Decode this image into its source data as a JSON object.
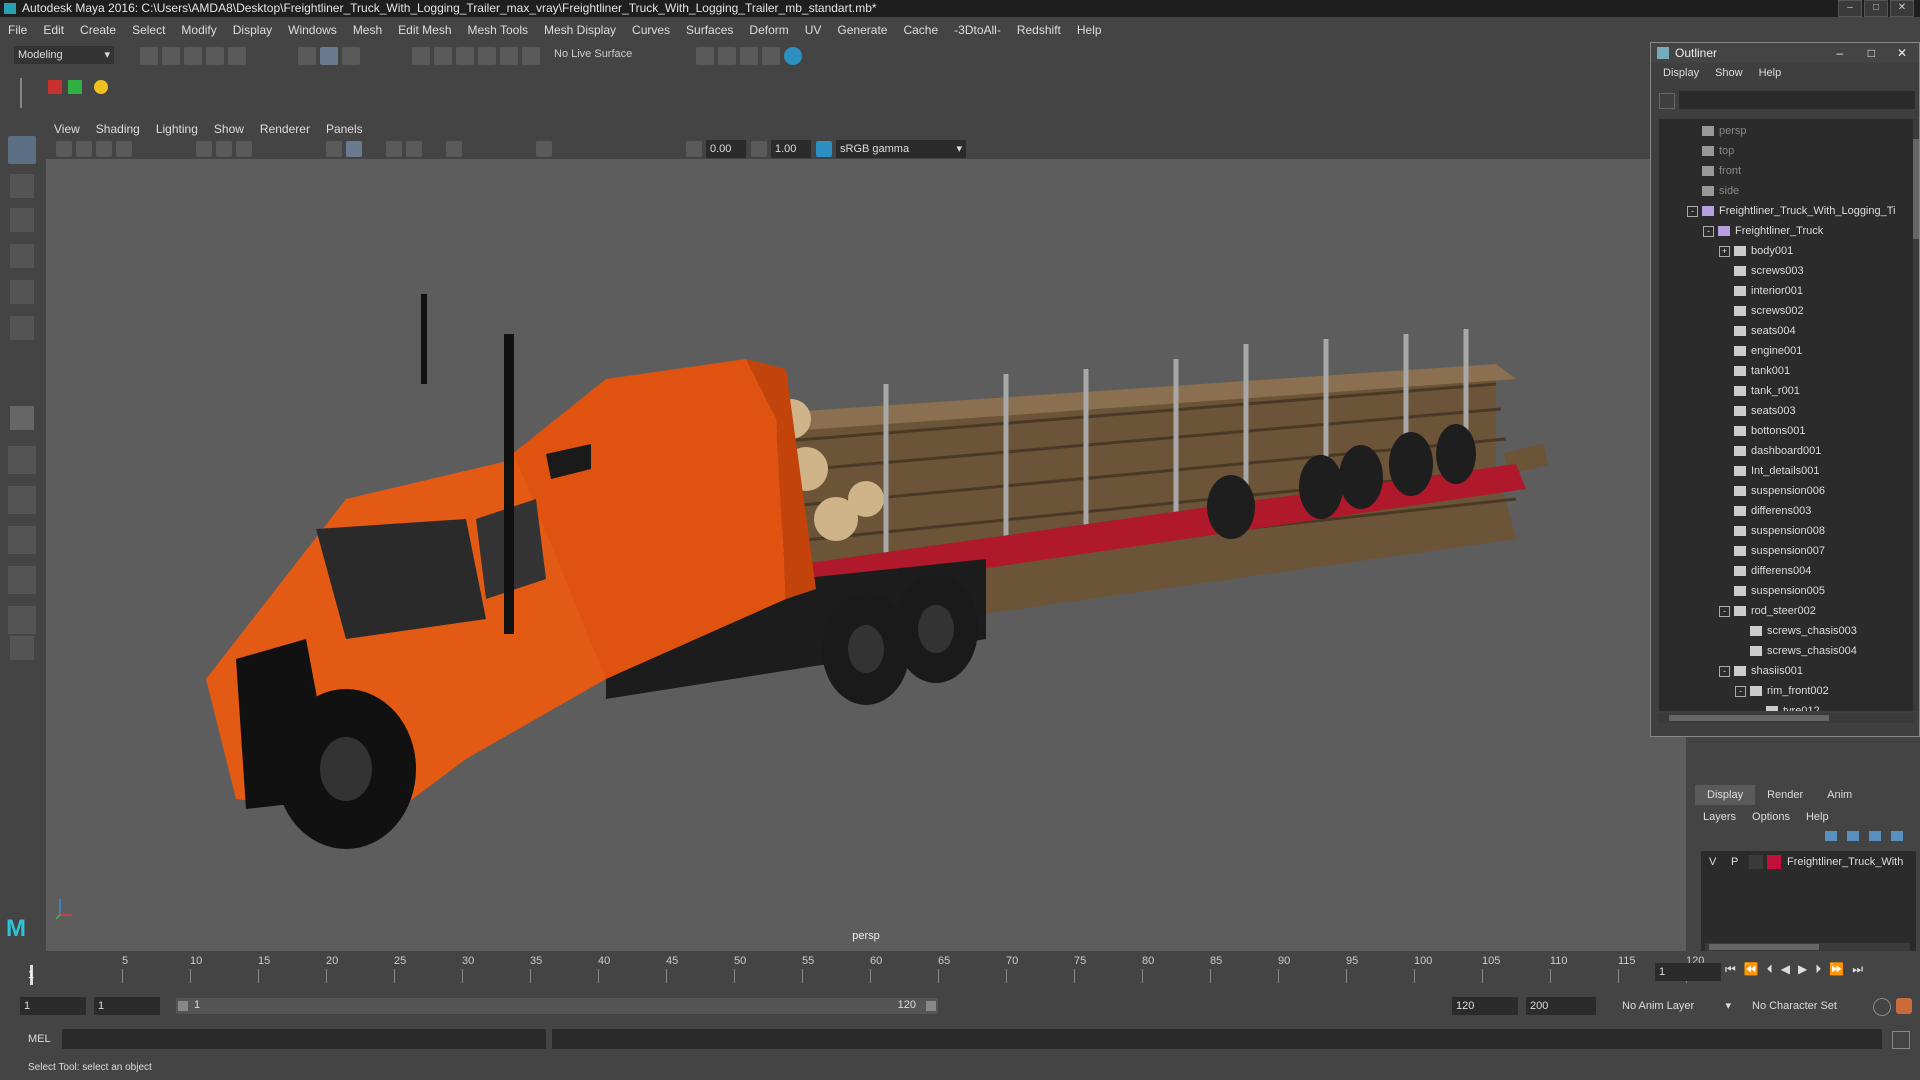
{
  "window": {
    "title": "Autodesk Maya 2016: C:\\Users\\AMDA8\\Desktop\\Freightliner_Truck_With_Logging_Trailer_max_vray\\Freightliner_Truck_With_Logging_Trailer_mb_standart.mb*"
  },
  "menubar": [
    "File",
    "Edit",
    "Create",
    "Select",
    "Modify",
    "Display",
    "Windows",
    "Mesh",
    "Edit Mesh",
    "Mesh Tools",
    "Mesh Display",
    "Curves",
    "Surfaces",
    "Deform",
    "UV",
    "Generate",
    "Cache",
    "-3DtoAll-",
    "Redshift",
    "Help"
  ],
  "shelf": {
    "mode": "Modeling",
    "live_surface": "No Live Surface"
  },
  "viewport": {
    "menu": [
      "View",
      "Shading",
      "Lighting",
      "Show",
      "Renderer",
      "Panels"
    ],
    "field_a": "0.00",
    "field_b": "1.00",
    "color_space": "sRGB gamma",
    "camera_label": "persp"
  },
  "outliner": {
    "title": "Outliner",
    "menu": [
      "Display",
      "Show",
      "Help"
    ],
    "items": [
      {
        "label": "persp",
        "level": 0,
        "dim": true,
        "icon": "camera-icon"
      },
      {
        "label": "top",
        "level": 0,
        "dim": true,
        "icon": "camera-icon"
      },
      {
        "label": "front",
        "level": 0,
        "dim": true,
        "icon": "camera-icon"
      },
      {
        "label": "side",
        "level": 0,
        "dim": true,
        "icon": "camera-icon"
      },
      {
        "label": "Freightliner_Truck_With_Logging_Ti",
        "level": 0,
        "exp": "-",
        "icon": "group-icon"
      },
      {
        "label": "Freightliner_Truck",
        "level": 1,
        "exp": "-",
        "icon": "group-icon"
      },
      {
        "label": "body001",
        "level": 2,
        "exp": "+",
        "icon": "mesh-icon"
      },
      {
        "label": "screws003",
        "level": 2,
        "icon": "mesh-icon"
      },
      {
        "label": "interior001",
        "level": 2,
        "icon": "mesh-icon"
      },
      {
        "label": "screws002",
        "level": 2,
        "icon": "mesh-icon"
      },
      {
        "label": "seats004",
        "level": 2,
        "icon": "mesh-icon"
      },
      {
        "label": "engine001",
        "level": 2,
        "icon": "mesh-icon"
      },
      {
        "label": "tank001",
        "level": 2,
        "icon": "mesh-icon"
      },
      {
        "label": "tank_r001",
        "level": 2,
        "icon": "mesh-icon"
      },
      {
        "label": "seats003",
        "level": 2,
        "icon": "mesh-icon"
      },
      {
        "label": "bottons001",
        "level": 2,
        "icon": "mesh-icon"
      },
      {
        "label": "dashboard001",
        "level": 2,
        "icon": "mesh-icon"
      },
      {
        "label": "Int_details001",
        "level": 2,
        "icon": "mesh-icon"
      },
      {
        "label": "suspension006",
        "level": 2,
        "icon": "mesh-icon"
      },
      {
        "label": "differens003",
        "level": 2,
        "icon": "mesh-icon"
      },
      {
        "label": "suspension008",
        "level": 2,
        "icon": "mesh-icon"
      },
      {
        "label": "suspension007",
        "level": 2,
        "icon": "mesh-icon"
      },
      {
        "label": "differens004",
        "level": 2,
        "icon": "mesh-icon"
      },
      {
        "label": "suspension005",
        "level": 2,
        "icon": "mesh-icon"
      },
      {
        "label": "rod_steer002",
        "level": 2,
        "exp": "-",
        "icon": "mesh-icon"
      },
      {
        "label": "screws_chasis003",
        "level": 3,
        "icon": "mesh-icon"
      },
      {
        "label": "screws_chasis004",
        "level": 3,
        "icon": "mesh-icon"
      },
      {
        "label": "shasiis001",
        "level": 2,
        "exp": "-",
        "icon": "mesh-icon"
      },
      {
        "label": "rim_front002",
        "level": 3,
        "exp": "-",
        "icon": "mesh-icon"
      },
      {
        "label": "tyre012",
        "level": 4,
        "icon": "mesh-icon"
      }
    ]
  },
  "layers": {
    "tabs": [
      "Display",
      "Render",
      "Anim"
    ],
    "menu": [
      "Layers",
      "Options",
      "Help"
    ],
    "row": {
      "v": "V",
      "p": "P",
      "name": "Freightliner_Truck_With",
      "color": "#c0103a"
    }
  },
  "timeline": {
    "ticks": [
      "5",
      "10",
      "15",
      "20",
      "25",
      "30",
      "35",
      "40",
      "45",
      "50",
      "55",
      "60",
      "65",
      "70",
      "75",
      "80",
      "85",
      "90",
      "95",
      "100",
      "105",
      "110",
      "115",
      "120"
    ],
    "start_tick": "1",
    "current_frame": "1"
  },
  "range": {
    "start": "1",
    "start2": "1",
    "slider_start": "1",
    "slider_end": "120",
    "end": "120",
    "end2": "200",
    "anim_layer": "No Anim Layer",
    "char_set": "No Character Set"
  },
  "cmd": {
    "label": "MEL"
  },
  "help": {
    "text": "Select Tool: select an object"
  }
}
